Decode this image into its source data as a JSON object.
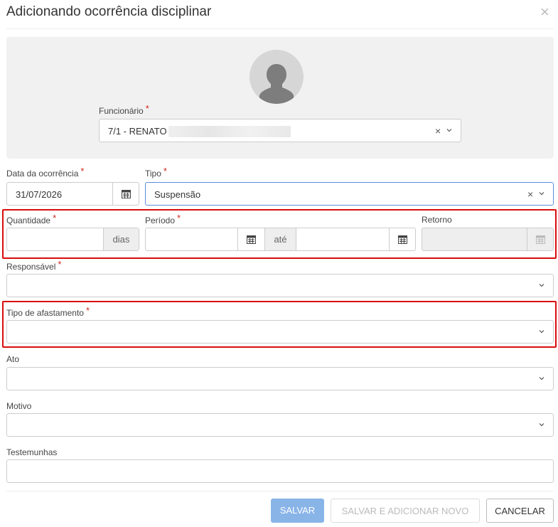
{
  "modal": {
    "title": "Adicionando ocorrência disciplinar",
    "close_glyph": "×"
  },
  "employee": {
    "label": "Funcionário",
    "value": "7/1 - RENATO",
    "required_mark": "*"
  },
  "date": {
    "label": "Data da ocorrência",
    "value": "31/07/2026",
    "required_mark": "*"
  },
  "tipo": {
    "label": "Tipo",
    "value": "Suspensão",
    "required_mark": "*"
  },
  "quantidade": {
    "label": "Quantidade",
    "value": "",
    "addon": "dias",
    "required_mark": "*"
  },
  "periodo": {
    "label": "Período",
    "start": "",
    "end": "",
    "addon": "até",
    "required_mark": "*"
  },
  "retorno": {
    "label": "Retorno",
    "value": ""
  },
  "responsavel": {
    "label": "Responsável",
    "value": "",
    "required_mark": "*"
  },
  "tipo_afastamento": {
    "label": "Tipo de afastamento",
    "value": "",
    "required_mark": "*"
  },
  "ato": {
    "label": "Ato",
    "value": ""
  },
  "motivo": {
    "label": "Motivo",
    "value": ""
  },
  "testemunhas": {
    "label": "Testemunhas",
    "value": ""
  },
  "buttons": {
    "save": "SALVAR",
    "save_new": "SALVAR E ADICIONAR NOVO",
    "cancel": "CANCELAR"
  },
  "colors": {
    "required": "#d0281e",
    "highlight": "#d80c0c",
    "primary_disabled": "#89b4e8",
    "focus_border": "#5b8ed8"
  }
}
